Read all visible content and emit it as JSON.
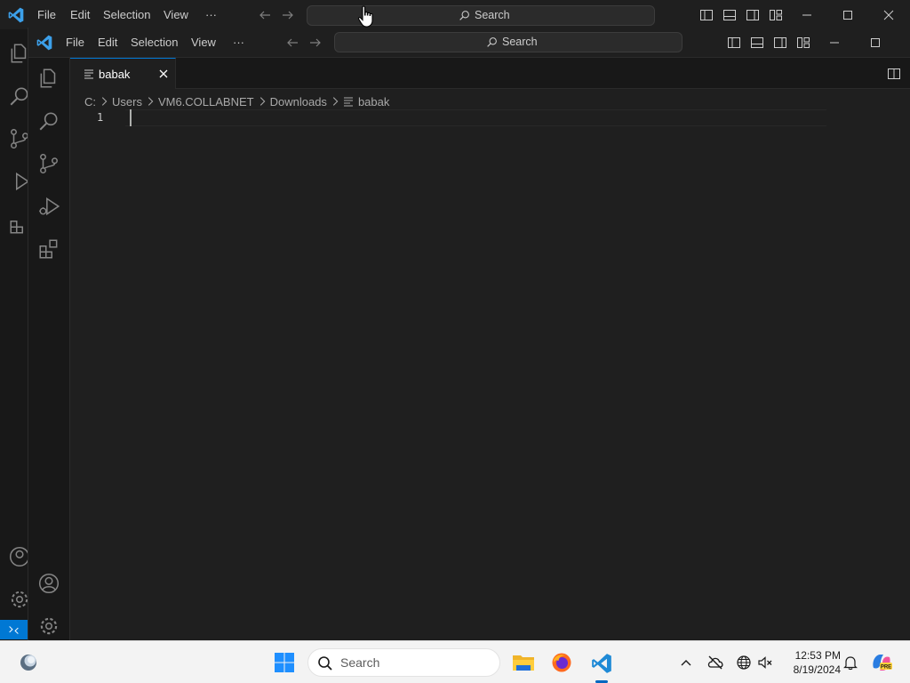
{
  "window": {
    "menu": [
      "File",
      "Edit",
      "Selection",
      "View",
      "···"
    ],
    "search_label": "Search"
  },
  "editor": {
    "tab_label": "babak",
    "breadcrumb": [
      "C:",
      "Users",
      "VM6.COLLABNET",
      "Downloads",
      "babak"
    ],
    "line_number": "1"
  },
  "taskbar": {
    "search_label": "Search",
    "time": "12:53 PM",
    "date": "8/19/2024"
  },
  "colors": {
    "accent": "#0078d4",
    "editor_bg": "#1f1f1f",
    "activity_bg": "#181818"
  }
}
